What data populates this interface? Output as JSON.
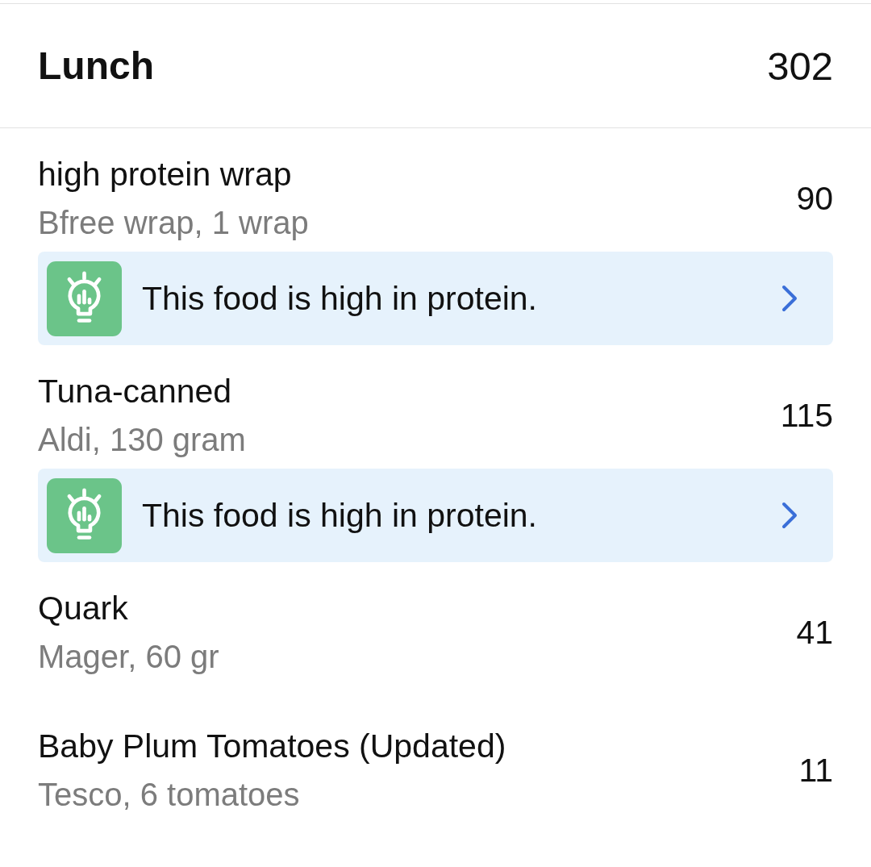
{
  "meal": {
    "title": "Lunch",
    "total": "302"
  },
  "entries": [
    {
      "name": "high protein wrap",
      "detail": "Bfree wrap, 1 wrap",
      "calories": "90",
      "tip": {
        "text": "This food is high in protein."
      }
    },
    {
      "name": "Tuna-canned",
      "detail": "Aldi, 130 gram",
      "calories": "115",
      "tip": {
        "text": "This food is high in protein."
      }
    },
    {
      "name": "Quark",
      "detail": "Mager, 60 gr",
      "calories": "41"
    },
    {
      "name": "Baby Plum Tomatoes (Updated)",
      "detail": "Tesco, 6 tomatoes",
      "calories": "11"
    }
  ]
}
